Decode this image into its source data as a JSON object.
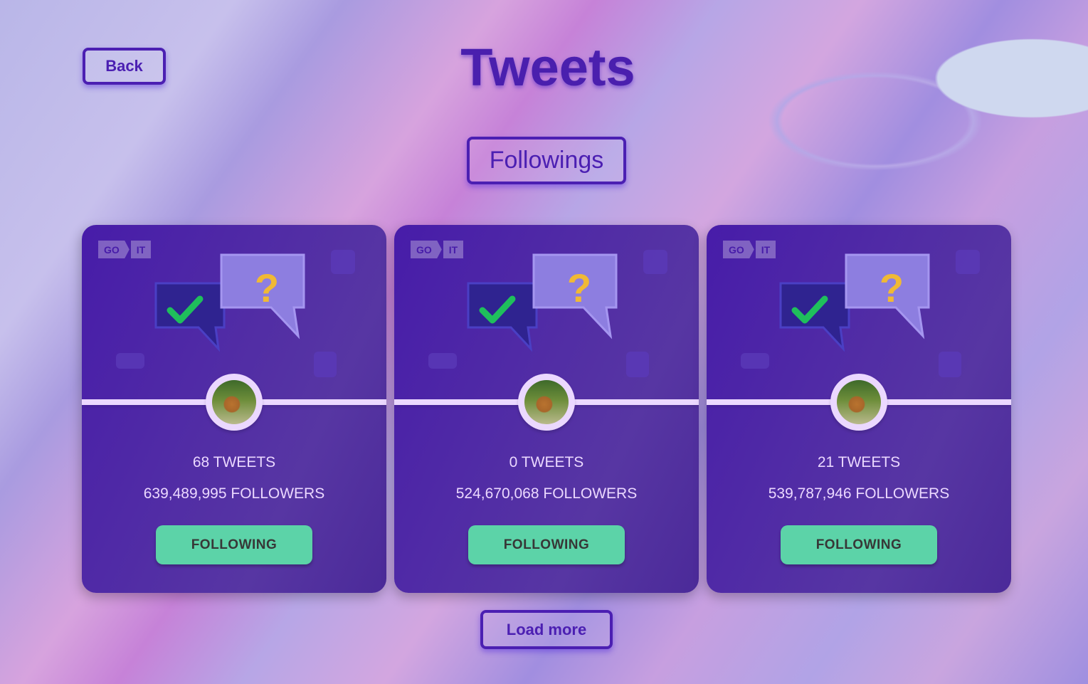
{
  "header": {
    "back_label": "Back",
    "title": "Tweets",
    "filter_label": "Followings"
  },
  "logo": {
    "left": "GO",
    "right": "IT"
  },
  "cards": [
    {
      "tweets": "68 TWEETS",
      "followers": "639,489,995 FOLLOWERS",
      "button": "FOLLOWING"
    },
    {
      "tweets": "0 TWEETS",
      "followers": "524,670,068 FOLLOWERS",
      "button": "FOLLOWING"
    },
    {
      "tweets": "21 TWEETS",
      "followers": "539,787,946 FOLLOWERS",
      "button": "FOLLOWING"
    }
  ],
  "load_more_label": "Load more",
  "colors": {
    "accent": "#471ca9",
    "button": "#5cd3a8",
    "text": "#ebd8ff"
  }
}
